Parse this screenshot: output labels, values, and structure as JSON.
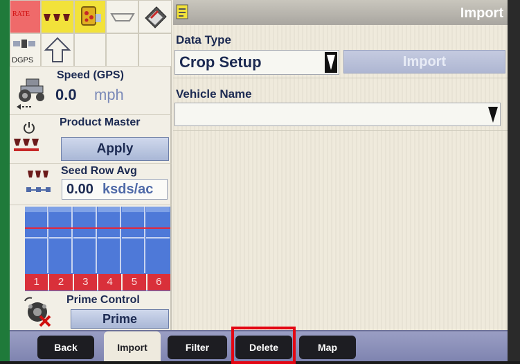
{
  "header": {
    "title": "Import"
  },
  "status_grid": {
    "rate_label": "RATE",
    "dgps_label": "DGPS"
  },
  "speed": {
    "title": "Speed (GPS)",
    "value": "0.0",
    "unit": "mph"
  },
  "product_master": {
    "title": "Product Master",
    "button_label": "Apply"
  },
  "seed_row_avg": {
    "title": "Seed Row Avg",
    "value": "0.00",
    "unit": "ksds/ac"
  },
  "row_numbers": [
    "1",
    "2",
    "3",
    "4",
    "5",
    "6"
  ],
  "prime_control": {
    "title": "Prime Control",
    "button_label": "Prime"
  },
  "form": {
    "data_type_label": "Data Type",
    "data_type_value": "Crop Setup",
    "import_button_label": "Import",
    "vehicle_name_label": "Vehicle Name",
    "vehicle_name_value": ""
  },
  "tabs": [
    "Back",
    "Import",
    "Filter",
    "Delete",
    "Map"
  ],
  "colors": {
    "accent_red": "#e30613",
    "title_text": "#1c2a52",
    "button_blue": "#a9b7d6",
    "tab_bar": "#8f93bb"
  }
}
